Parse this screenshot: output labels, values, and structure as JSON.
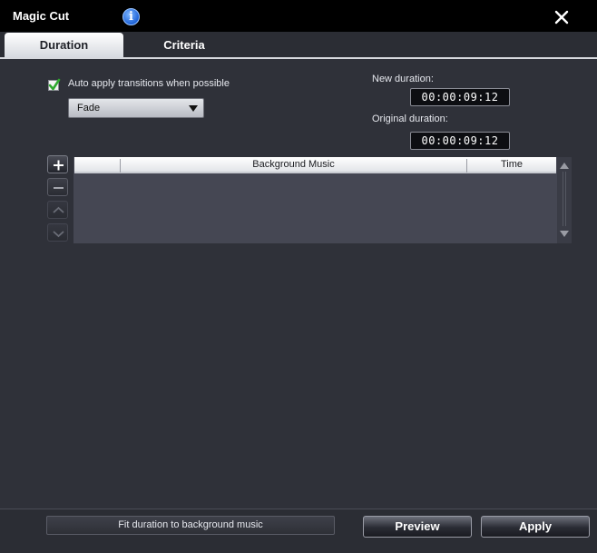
{
  "window": {
    "title": "Magic Cut",
    "info_icon": "info-icon",
    "close_icon": "close-icon"
  },
  "tabs": [
    {
      "label": "Duration",
      "active": true
    },
    {
      "label": "Criteria",
      "active": false
    }
  ],
  "duration": {
    "auto_apply_label": "Auto apply transitions when possible",
    "auto_apply_checked": true,
    "transition_selected": "Fade",
    "new_duration_label": "New duration:",
    "new_duration_value": "00:00:09:12",
    "original_duration_label": "Original duration:",
    "original_duration_value": "00:00:09:12"
  },
  "music_list": {
    "side_buttons": [
      "plus-icon",
      "minus-icon",
      "chevron-up-icon",
      "chevron-down-icon"
    ],
    "columns": [
      "",
      "Background Music",
      "Time"
    ],
    "rows": []
  },
  "footer": {
    "fit_label": "Fit duration to background music",
    "preview_label": "Preview",
    "apply_label": "Apply"
  },
  "colors": {
    "background": "#2f3139",
    "titlebar": "#000000",
    "grid_background": "#454753",
    "checkmark": "#2fa82f"
  }
}
